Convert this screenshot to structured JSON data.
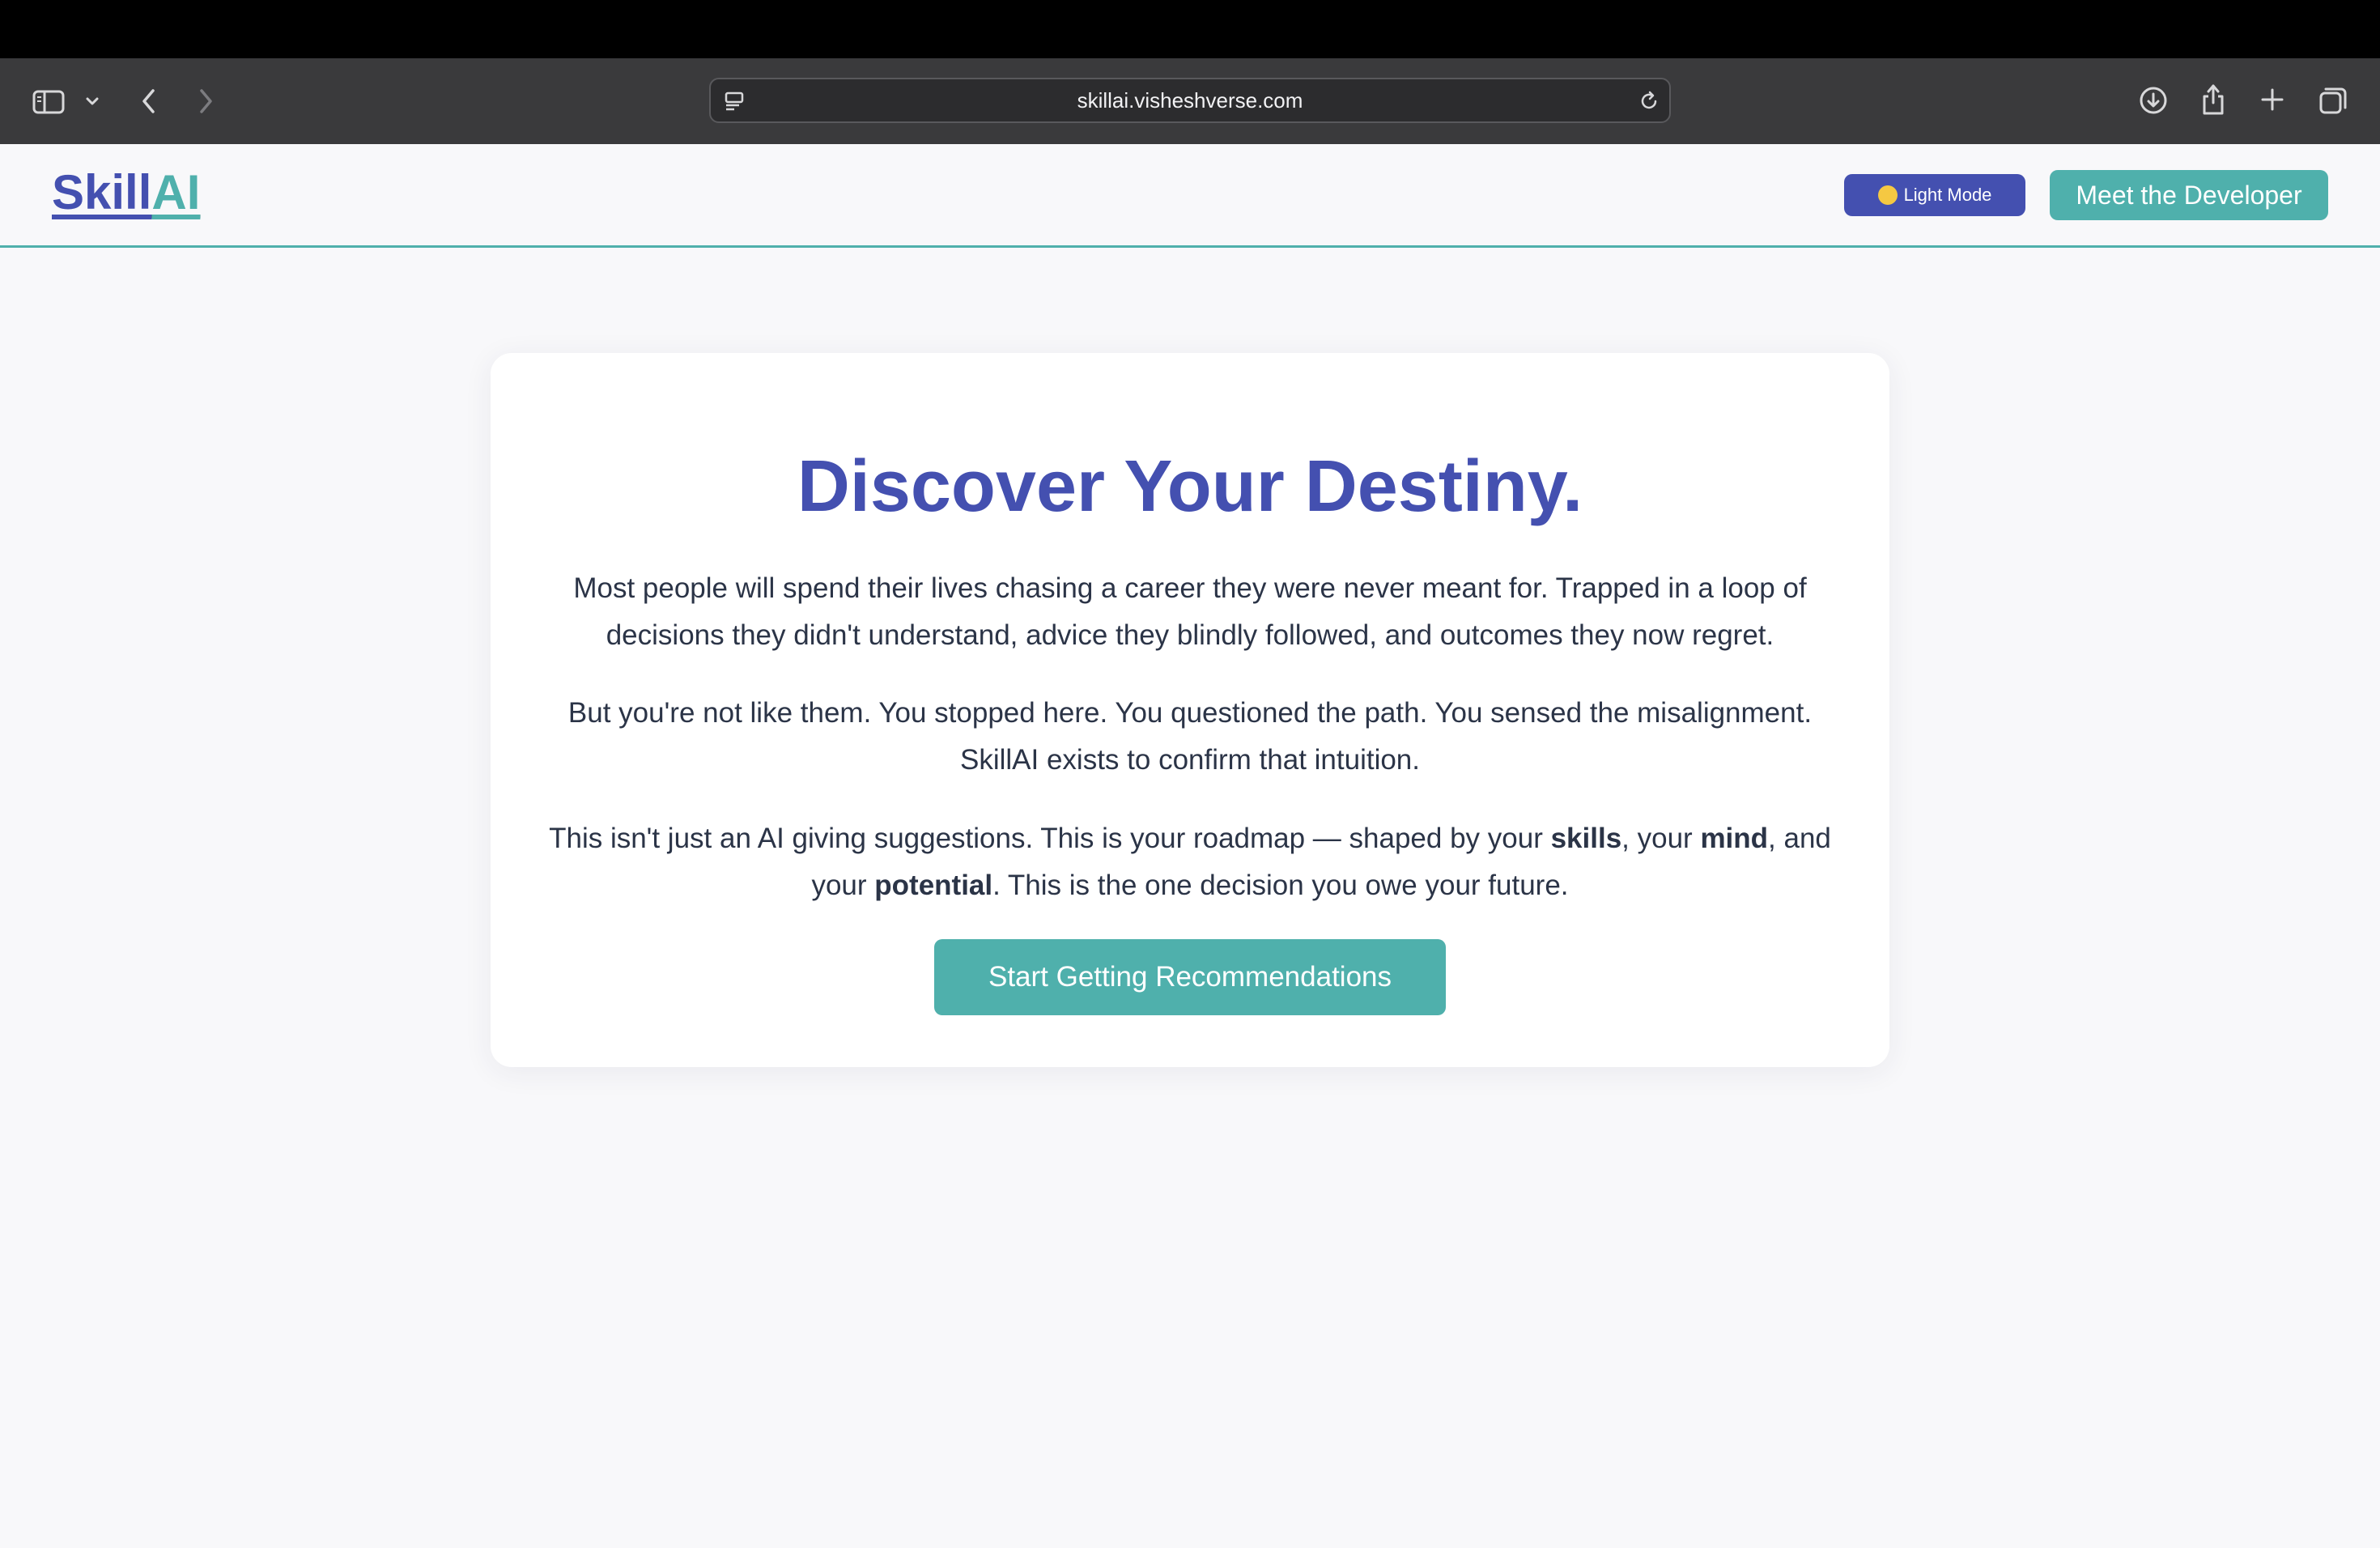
{
  "browser": {
    "url": "skillai.visheshverse.com",
    "icons": {
      "sidebar": "sidebar-icon",
      "sidebar_menu": "chevron-down-icon",
      "back": "chevron-left-icon",
      "forward": "chevron-right-icon",
      "site_info": "page-settings-icon",
      "reload": "reload-icon",
      "downloads": "download-icon",
      "share": "share-icon",
      "new_tab": "plus-icon",
      "tab_overview": "tabs-icon"
    }
  },
  "header": {
    "logo_part1": "Skill",
    "logo_part2": "AI",
    "mode_button_icon": "🌞",
    "mode_button_label": "Light Mode",
    "developer_button_label": "Meet the Developer"
  },
  "hero": {
    "title": "Discover Your Destiny.",
    "paragraph1": "Most people will spend their lives chasing a career they were never meant for. Trapped in a loop of decisions they didn't understand, advice they blindly followed, and outcomes they now regret.",
    "paragraph2_line1": "But you're not like them. You stopped here. You questioned the path. You sensed the misalignment.",
    "paragraph2_line2": "SkillAI exists to confirm that intuition.",
    "paragraph3": {
      "t1": "This isn't just an AI giving suggestions. This is your roadmap — shaped by your ",
      "b1": "skills",
      "t2": ", your ",
      "b2": "mind",
      "t3": ", and your ",
      "b3": "potential",
      "t4": ". This is the one decision you owe your future."
    },
    "cta_label": "Start Getting Recommendations"
  },
  "colors": {
    "primary": "#4450b0",
    "accent": "#4fb0ac",
    "background": "#f8f8fa",
    "text": "#2b3447"
  }
}
